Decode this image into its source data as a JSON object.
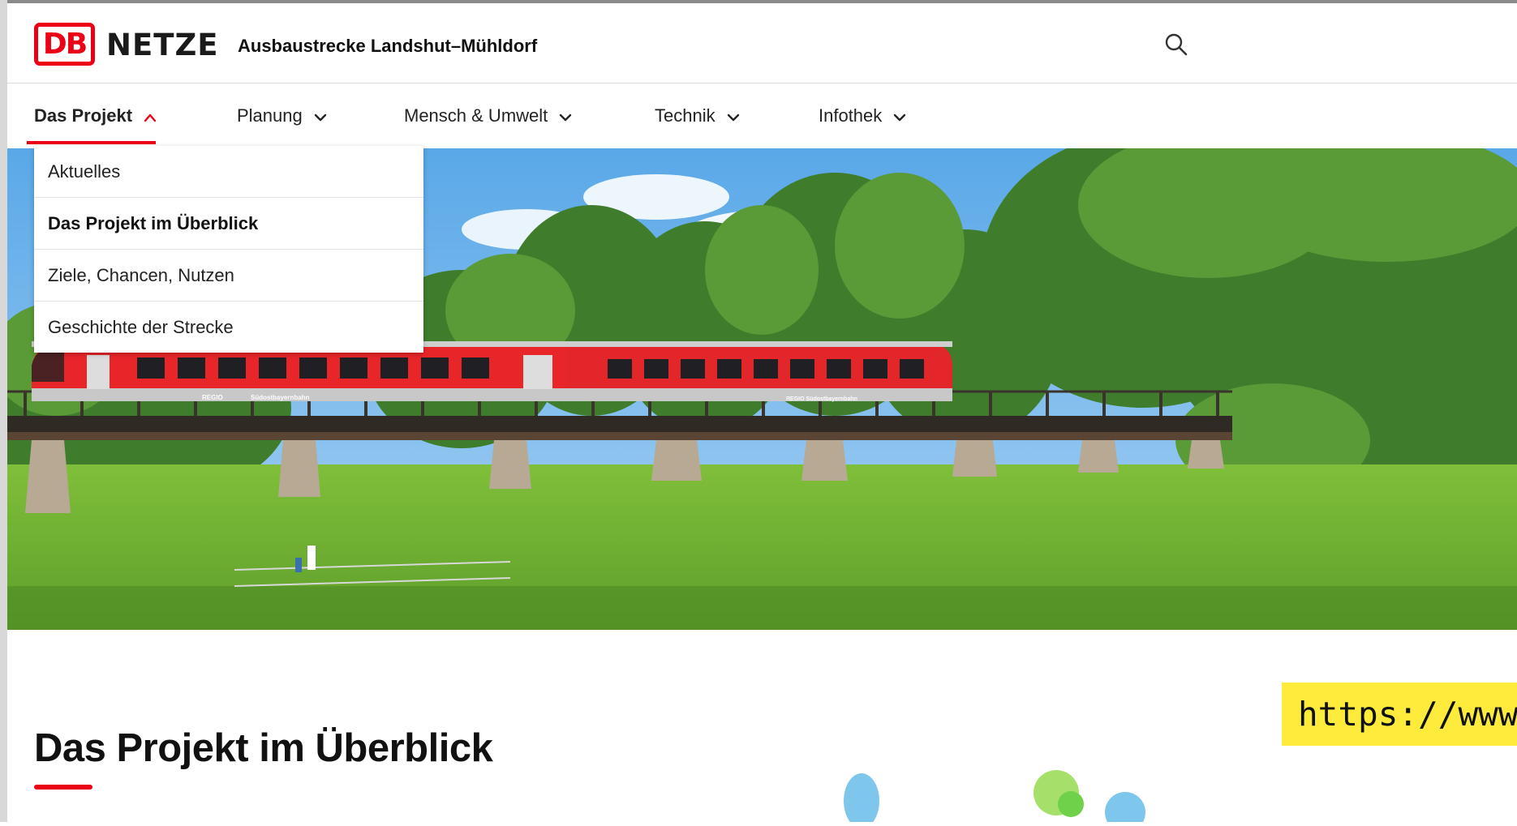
{
  "header": {
    "logo_db": "DB",
    "logo_netze": "NETZE",
    "site_title": "Ausbaustrecke Landshut–Mühldorf",
    "search_icon": "search-icon"
  },
  "nav": {
    "items": [
      {
        "label": "Das Projekt",
        "expanded": true
      },
      {
        "label": "Planung",
        "expanded": false
      },
      {
        "label": "Mensch & Umwelt",
        "expanded": false
      },
      {
        "label": "Technik",
        "expanded": false
      },
      {
        "label": "Infothek",
        "expanded": false
      }
    ]
  },
  "dropdown": {
    "items": [
      {
        "label": "Aktuelles"
      },
      {
        "label": "Das Projekt im Überblick",
        "current": true
      },
      {
        "label": "Ziele, Chancen, Nutzen"
      },
      {
        "label": "Geschichte der Strecke"
      }
    ]
  },
  "hero": {
    "train_text_left": "REGIO",
    "train_text_mid": "Südostbayernbahn",
    "train_text_right": "REGIO Südostbayernbahn"
  },
  "main": {
    "page_title": "Das Projekt im Überblick"
  },
  "overlay": {
    "url_text": "https://www"
  },
  "colors": {
    "brand_red": "#ec0016",
    "url_highlight": "#ffeb3b"
  }
}
